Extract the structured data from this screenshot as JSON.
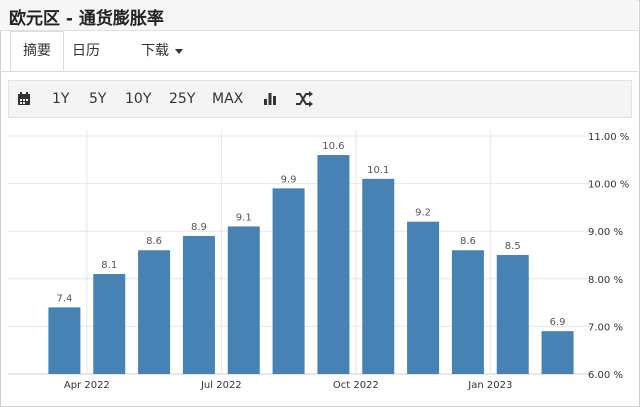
{
  "header": {
    "title": "欧元区 - 通货膨胀率"
  },
  "tabs": [
    {
      "label": "摘要"
    },
    {
      "label": "日历"
    },
    {
      "label": "下载"
    }
  ],
  "toolbar": {
    "icons": [
      "calendar-icon",
      "bar-chart-icon",
      "shuffle-icon"
    ],
    "ranges": [
      "1Y",
      "5Y",
      "10Y",
      "25Y",
      "MAX"
    ]
  },
  "chart_data": {
    "type": "bar",
    "categories": [
      "2022-03",
      "2022-04",
      "2022-05",
      "2022-06",
      "2022-07",
      "2022-08",
      "2022-09",
      "2022-10",
      "2022-11",
      "2022-12",
      "2023-01",
      "2023-02"
    ],
    "values": [
      7.4,
      8.1,
      8.6,
      8.9,
      9.1,
      9.9,
      10.6,
      10.1,
      9.2,
      8.6,
      8.5,
      6.9
    ],
    "data_labels": [
      "7.4",
      "8.1",
      "8.6",
      "8.9",
      "9.1",
      "9.9",
      "10.6",
      "10.1",
      "9.2",
      "8.6",
      "8.5",
      "6.9"
    ],
    "x_ticks": [
      {
        "label": "Apr 2022",
        "index": 0.5
      },
      {
        "label": "Jul 2022",
        "index": 3.5
      },
      {
        "label": "Oct 2022",
        "index": 6.5
      },
      {
        "label": "Jan 2023",
        "index": 9.5
      }
    ],
    "y_ticks": [
      {
        "value": 6,
        "label": "6.00 %"
      },
      {
        "value": 7,
        "label": "7.00 %"
      },
      {
        "value": 8,
        "label": "8.00 %"
      },
      {
        "value": 9,
        "label": "9.00 %"
      },
      {
        "value": 10,
        "label": "10.00 %"
      },
      {
        "value": 11,
        "label": "11.00 %"
      }
    ],
    "ylim": [
      6,
      11
    ],
    "y_axis_position": "right",
    "grid": true,
    "bar_color": "#4682b4"
  }
}
